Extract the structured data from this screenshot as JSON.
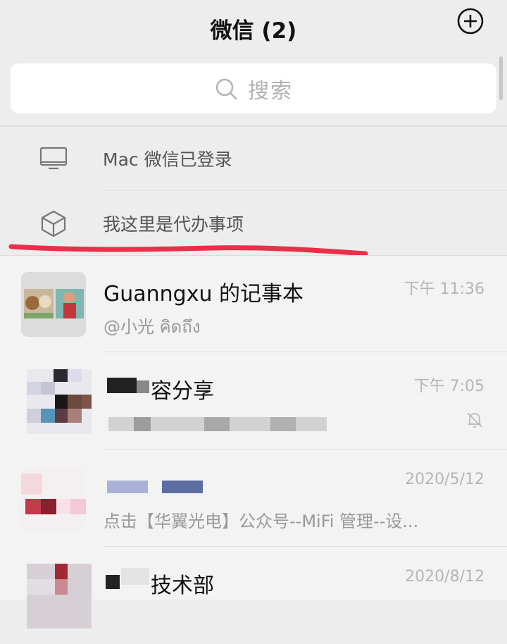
{
  "header": {
    "title": "微信 (2)"
  },
  "search": {
    "placeholder": "搜索"
  },
  "system_items": [
    {
      "label": "Mac 微信已登录",
      "icon": "desktop-icon"
    },
    {
      "label": "我这里是代办事项",
      "icon": "cube-icon"
    }
  ],
  "chats": [
    {
      "name": "Guanngxu 的记事本",
      "subtitle": "@小光 คิดถึง",
      "time": "下午 11:36"
    },
    {
      "name": "容分享",
      "subtitle": "",
      "time": "下午 7:05",
      "muted": true
    },
    {
      "name": "",
      "subtitle": "点击【华翼光电】公众号--MiFi 管理--设...",
      "time": "2020/5/12"
    },
    {
      "name": "技术部",
      "subtitle": "",
      "time": "2020/8/12"
    }
  ],
  "colors": {
    "background": "#ededed",
    "list_background": "#f3f3f3",
    "annotation_red": "#e8304a"
  }
}
